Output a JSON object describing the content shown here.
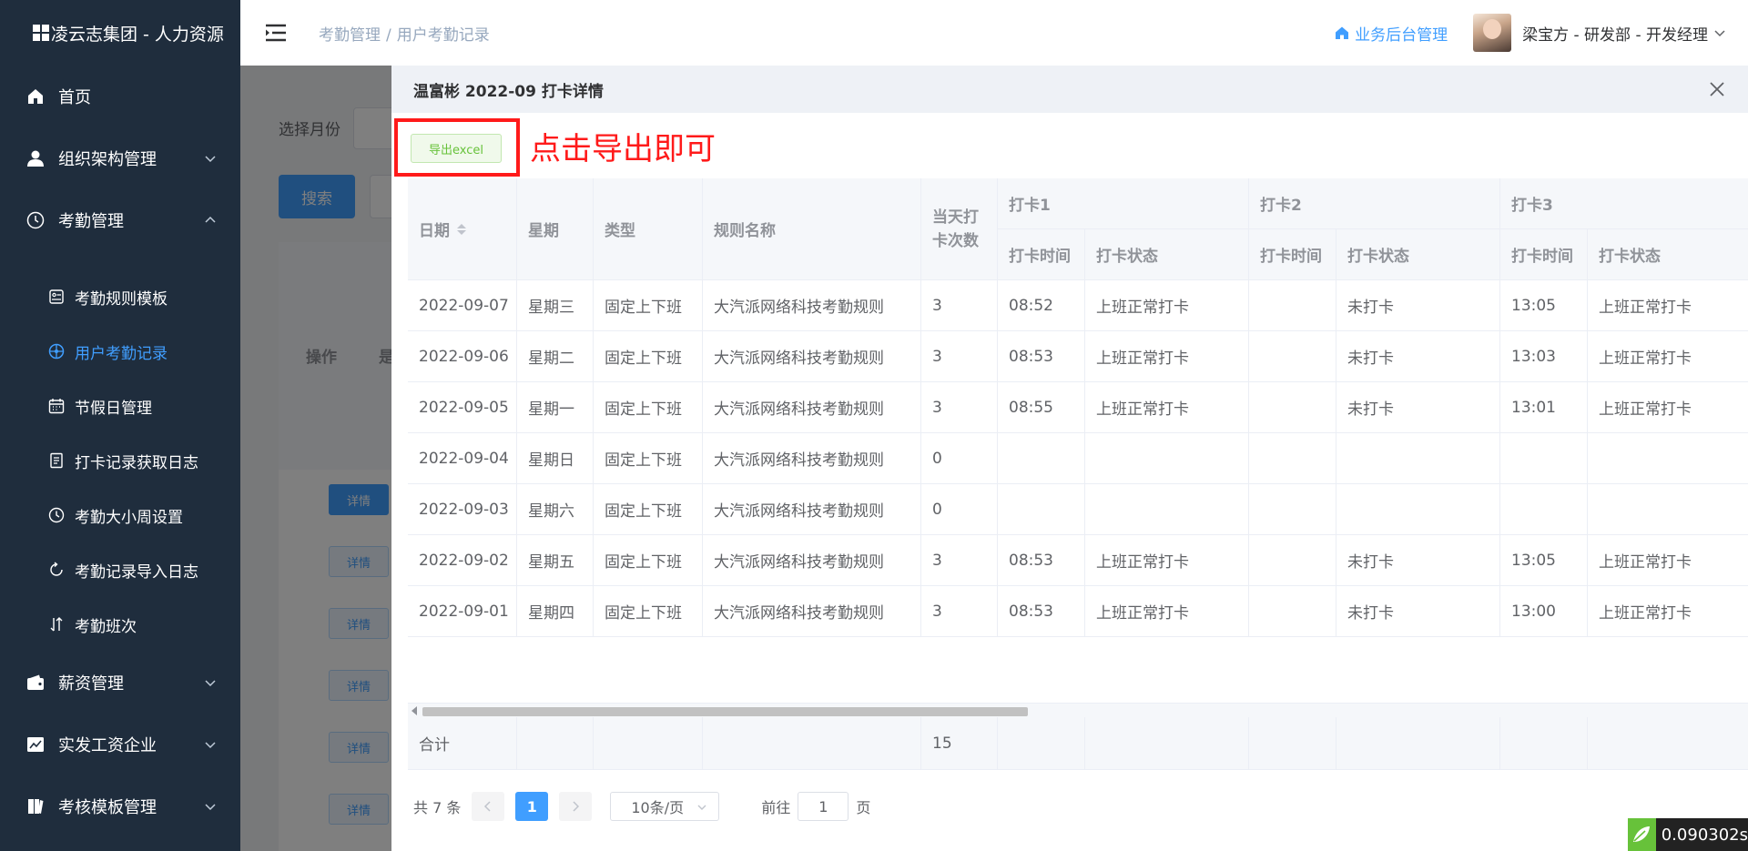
{
  "app": {
    "logo_text": "凌云志集团 - 人力资源"
  },
  "sidebar": {
    "items": [
      {
        "label": "首页",
        "icon": "home-icon"
      },
      {
        "label": "组织架构管理",
        "icon": "user-icon",
        "expandable": true,
        "expanded": false
      },
      {
        "label": "考勤管理",
        "icon": "clock-icon",
        "expandable": true,
        "expanded": true
      },
      {
        "label": "薪资管理",
        "icon": "wallet-icon",
        "expandable": true,
        "expanded": false
      },
      {
        "label": "实发工资企业",
        "icon": "chart-icon",
        "expandable": true,
        "expanded": false
      },
      {
        "label": "考核模板管理",
        "icon": "book-icon",
        "expandable": true,
        "expanded": false
      }
    ],
    "subitems": [
      {
        "label": "考勤规则模板",
        "icon": "template-icon"
      },
      {
        "label": "用户考勤记录",
        "icon": "compass-icon",
        "active": true
      },
      {
        "label": "节假日管理",
        "icon": "calendar-icon"
      },
      {
        "label": "打卡记录获取日志",
        "icon": "document-icon"
      },
      {
        "label": "考勤大小周设置",
        "icon": "clock-icon"
      },
      {
        "label": "考勤记录导入日志",
        "icon": "refresh-icon"
      },
      {
        "label": "考勤班次",
        "icon": "sort-icon"
      }
    ]
  },
  "header": {
    "breadcrumb": [
      "考勤管理",
      "用户考勤记录"
    ],
    "biz_link": "业务后台管理",
    "user": "梁宝方 - 研发部 - 开发经理"
  },
  "background": {
    "month_label": "选择月份",
    "search_label": "搜索",
    "op_header": "操作",
    "is_header": "是",
    "detail_label": "详情"
  },
  "drawer": {
    "title": "温富彬 2022-09 打卡详情",
    "export_label": "导出excel",
    "annotation": "点击导出即可"
  },
  "table": {
    "headers": {
      "date": "日期",
      "weekday": "星期",
      "type": "类型",
      "rule": "规则名称",
      "count": "当天打卡次数",
      "punch1": "打卡1",
      "punch2": "打卡2",
      "punch3": "打卡3",
      "time": "打卡时间",
      "status": "打卡状态"
    },
    "rows": [
      {
        "date": "2022-09-07",
        "weekday": "星期三",
        "type": "固定上下班",
        "rule": "大汽派网络科技考勤规则",
        "count": "3",
        "t1": "08:52",
        "s1": "上班正常打卡",
        "t2": "",
        "s2": "未打卡",
        "t3": "13:05",
        "s3": "上班正常打卡"
      },
      {
        "date": "2022-09-06",
        "weekday": "星期二",
        "type": "固定上下班",
        "rule": "大汽派网络科技考勤规则",
        "count": "3",
        "t1": "08:53",
        "s1": "上班正常打卡",
        "t2": "",
        "s2": "未打卡",
        "t3": "13:03",
        "s3": "上班正常打卡"
      },
      {
        "date": "2022-09-05",
        "weekday": "星期一",
        "type": "固定上下班",
        "rule": "大汽派网络科技考勤规则",
        "count": "3",
        "t1": "08:55",
        "s1": "上班正常打卡",
        "t2": "",
        "s2": "未打卡",
        "t3": "13:01",
        "s3": "上班正常打卡"
      },
      {
        "date": "2022-09-04",
        "weekday": "星期日",
        "type": "固定上下班",
        "rule": "大汽派网络科技考勤规则",
        "count": "0",
        "t1": "",
        "s1": "",
        "t2": "",
        "s2": "",
        "t3": "",
        "s3": ""
      },
      {
        "date": "2022-09-03",
        "weekday": "星期六",
        "type": "固定上下班",
        "rule": "大汽派网络科技考勤规则",
        "count": "0",
        "t1": "",
        "s1": "",
        "t2": "",
        "s2": "",
        "t3": "",
        "s3": ""
      },
      {
        "date": "2022-09-02",
        "weekday": "星期五",
        "type": "固定上下班",
        "rule": "大汽派网络科技考勤规则",
        "count": "3",
        "t1": "08:53",
        "s1": "上班正常打卡",
        "t2": "",
        "s2": "未打卡",
        "t3": "13:05",
        "s3": "上班正常打卡"
      },
      {
        "date": "2022-09-01",
        "weekday": "星期四",
        "type": "固定上下班",
        "rule": "大汽派网络科技考勤规则",
        "count": "3",
        "t1": "08:53",
        "s1": "上班正常打卡",
        "t2": "",
        "s2": "未打卡",
        "t3": "13:00",
        "s3": "上班正常打卡"
      }
    ],
    "summary_label": "合计",
    "summary_count": "15"
  },
  "pagination": {
    "total_text": "共 7 条",
    "current_page": "1",
    "page_size": "10条/页",
    "goto_label": "前往",
    "goto_value": "1",
    "page_suffix": "页"
  },
  "timer": {
    "value": "0.090302s"
  },
  "colors": {
    "sidebar_bg": "#1f2d3d",
    "accent": "#409eff",
    "annotation_red": "#ff1a1a",
    "export_green": "#67c23a"
  }
}
